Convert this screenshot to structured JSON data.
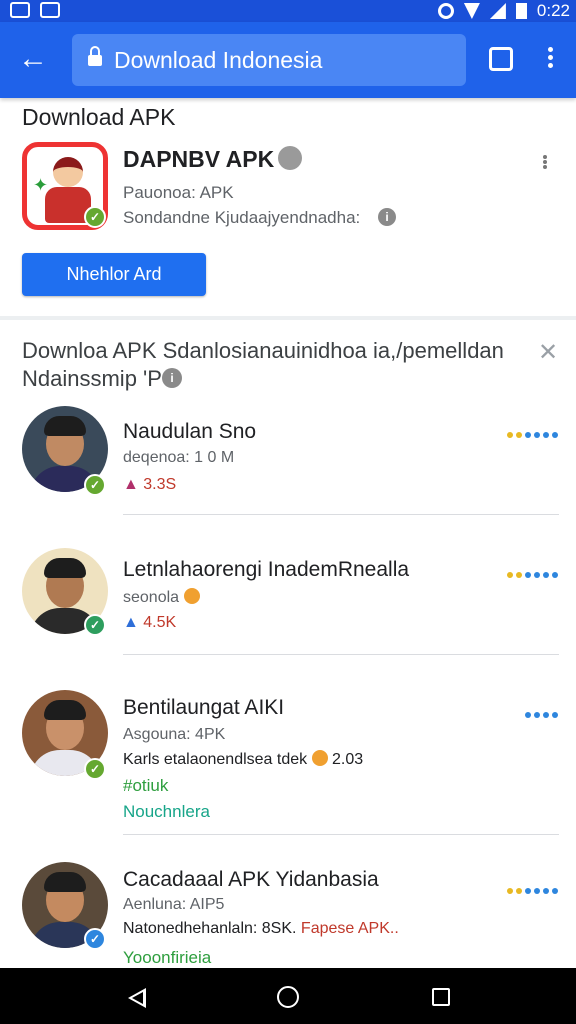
{
  "status_bar": {
    "time": "0:22"
  },
  "browser": {
    "url_text": "Download Indonesia",
    "tab_count": ""
  },
  "app": {
    "section_label": "Download APK",
    "title": "DAPNBV APK",
    "meta_line1": "Pauonoa: APK",
    "meta_line2": "Sondandne Kjudaajyendnadha:",
    "install_label": "Nhehlor Ard"
  },
  "results": {
    "heading_line1": "Downloa APK Sdanlosianauinidhoa ia,/pemelldan",
    "heading_line2": "Ndainssmip 'P",
    "items": [
      {
        "title": "Naudulan Sno",
        "subtitle": "deqenoa: 1 0 M",
        "stat": "3.3S",
        "stat_icon": "bag-icon",
        "stars": [
          "#e8b923",
          "#e8b923",
          "#2e86de",
          "#2e86de",
          "#2e86de",
          "#2e86de"
        ]
      },
      {
        "title": "Letnlahaorengi InademRnealla",
        "subtitle": "seonola",
        "stat": "4.5K",
        "stat_icon": "thumb-icon",
        "stars": [
          "#e8b923",
          "#e8b923",
          "#2e86de",
          "#2e86de",
          "#2e86de",
          "#2e86de"
        ]
      },
      {
        "title": "Bentilaungat AIKI",
        "subtitle": "Asgouna: 4PK",
        "detail": "Karls etalaonendlsea tdek",
        "detail_value": "2.03",
        "extra": "#otiuk",
        "link": "Nouchnlera",
        "stars": [
          "#2e86de",
          "#2e86de",
          "#2e86de",
          "#2e86de"
        ]
      },
      {
        "title": "Cacadaaal APK Yidanbasia",
        "subtitle": "Aenluna: AIP5",
        "detail": "Natonedhehanlaln: 8SK.",
        "detail_highlight": "Fapese APK..",
        "link": "Yooonfirieia",
        "stars": [
          "#e8b923",
          "#e8b923",
          "#2e86de",
          "#2e86de",
          "#2e86de",
          "#2e86de"
        ]
      }
    ]
  }
}
